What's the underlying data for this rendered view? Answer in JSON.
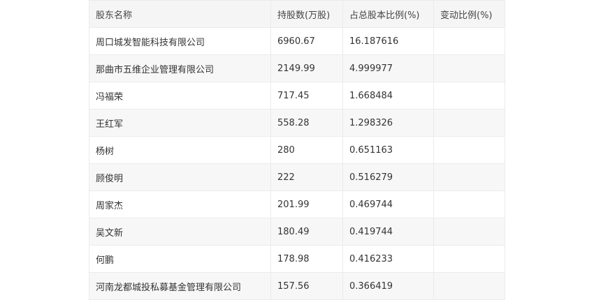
{
  "table": {
    "headers": [
      "股东名称",
      "持股数(万股)",
      "占总股本比例(%)",
      "变动比例(%)"
    ],
    "rows": [
      [
        "周口城发智能科技有限公司",
        "6960.67",
        "16.187616",
        ""
      ],
      [
        "那曲市五维企业管理有限公司",
        "2149.99",
        "4.999977",
        ""
      ],
      [
        "冯福荣",
        "717.45",
        "1.668484",
        ""
      ],
      [
        "王红军",
        "558.28",
        "1.298326",
        ""
      ],
      [
        "杨树",
        "280",
        "0.651163",
        ""
      ],
      [
        "顾俊明",
        "222",
        "0.516279",
        ""
      ],
      [
        "周家杰",
        "201.99",
        "0.469744",
        ""
      ],
      [
        "吴文新",
        "180.49",
        "0.419744",
        ""
      ],
      [
        "何鹏",
        "178.98",
        "0.416233",
        ""
      ],
      [
        "河南龙都城投私募基金管理有限公司",
        "157.56",
        "0.366419",
        ""
      ]
    ]
  }
}
